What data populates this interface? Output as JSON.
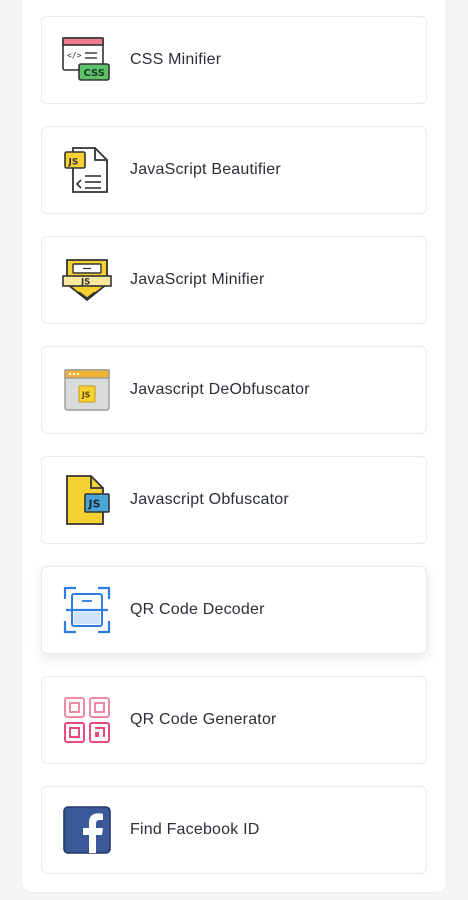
{
  "tools": [
    {
      "label": "CSS Minifier",
      "icon": "css-file-icon"
    },
    {
      "label": "JavaScript Beautifier",
      "icon": "js-file-icon"
    },
    {
      "label": "JavaScript Minifier",
      "icon": "js-badge-icon"
    },
    {
      "label": "Javascript DeObfuscator",
      "icon": "js-browser-icon"
    },
    {
      "label": "Javascript Obfuscator",
      "icon": "js-document-icon"
    },
    {
      "label": "QR Code Decoder",
      "icon": "qr-scan-icon"
    },
    {
      "label": "QR Code Generator",
      "icon": "qr-code-icon"
    },
    {
      "label": "Find Facebook ID",
      "icon": "facebook-icon"
    }
  ],
  "icon_text": {
    "css": "CSS",
    "code": "</>",
    "js": "JS"
  },
  "colors": {
    "css_green": "#5cc36a",
    "css_pink": "#f07a8e",
    "js_yellow": "#f5d132",
    "qr_blue": "#2f7de1",
    "qr_pink": "#ea4a78",
    "facebook_blue": "#3b5998"
  }
}
